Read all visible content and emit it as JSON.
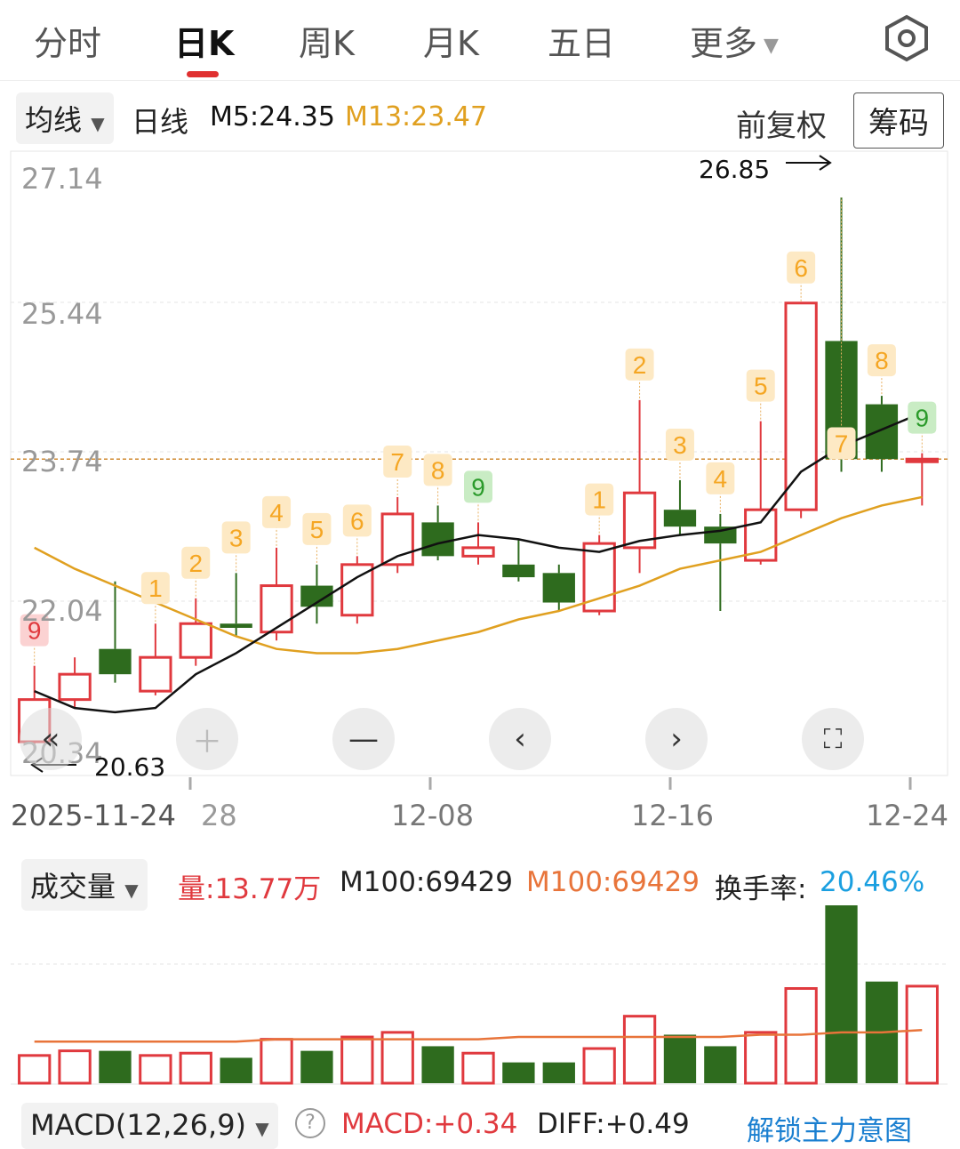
{
  "tabs": [
    {
      "label": "分时"
    },
    {
      "label": "日K"
    },
    {
      "label": "周K"
    },
    {
      "label": "月K"
    },
    {
      "label": "五日"
    },
    {
      "label": "更多"
    }
  ],
  "indicators": {
    "ma_selector": "均线",
    "period": "日线",
    "m5": "M5:24.35",
    "m13": "M13:23.47",
    "adjust": "前复权",
    "chip_button": "筹码"
  },
  "price_axis": {
    "labels": [
      "27.14",
      "25.44",
      "23.74",
      "22.04",
      "20.34"
    ]
  },
  "extremes": {
    "high_label": "26.85",
    "low_label": "20.63"
  },
  "date_axis": {
    "labels": [
      "2025-11-24",
      "28",
      "12-08",
      "12-16",
      "12-24"
    ]
  },
  "volume_header": {
    "selector": "成交量",
    "vol": "量:13.77万",
    "m100_a": "M100:69429",
    "m100_b": "M100:69429",
    "turnover_label": "换手率:",
    "turnover_value": "20.46%"
  },
  "macd_header": {
    "selector": "MACD(12,26,9)",
    "macd": "MACD:+0.34",
    "diff": "DIFF:+0.49",
    "link": "解锁主力意图"
  },
  "colors": {
    "up": "#e0393e",
    "down": "#2e6b1e",
    "ma5": "#111111",
    "ma13": "#e0a020",
    "turnover": "#1a9fe0",
    "badge": "#f5a623"
  },
  "chart_data": {
    "type": "candlestick",
    "ylim": [
      20.0,
      27.4
    ],
    "candles": [
      {
        "o": 20.4,
        "c": 20.9,
        "h": 21.3,
        "l": 20.3
      },
      {
        "o": 20.9,
        "c": 21.2,
        "h": 21.4,
        "l": 20.8
      },
      {
        "o": 21.5,
        "c": 21.2,
        "h": 22.3,
        "l": 21.1
      },
      {
        "o": 21.0,
        "c": 21.4,
        "h": 21.8,
        "l": 20.95
      },
      {
        "o": 21.4,
        "c": 21.8,
        "h": 22.1,
        "l": 21.3
      },
      {
        "o": 21.8,
        "c": 21.75,
        "h": 22.4,
        "l": 21.65
      },
      {
        "o": 21.7,
        "c": 22.25,
        "h": 22.7,
        "l": 21.6
      },
      {
        "o": 22.25,
        "c": 22.0,
        "h": 22.5,
        "l": 21.8
      },
      {
        "o": 21.9,
        "c": 22.5,
        "h": 22.6,
        "l": 21.8
      },
      {
        "o": 22.5,
        "c": 23.1,
        "h": 23.3,
        "l": 22.4
      },
      {
        "o": 23.0,
        "c": 22.6,
        "h": 23.2,
        "l": 22.55
      },
      {
        "o": 22.6,
        "c": 22.7,
        "h": 23.0,
        "l": 22.5
      },
      {
        "o": 22.5,
        "c": 22.35,
        "h": 22.8,
        "l": 22.3
      },
      {
        "o": 22.4,
        "c": 22.05,
        "h": 22.5,
        "l": 21.95
      },
      {
        "o": 21.95,
        "c": 22.75,
        "h": 22.85,
        "l": 21.9
      },
      {
        "o": 22.7,
        "c": 23.35,
        "h": 24.45,
        "l": 22.4
      },
      {
        "o": 23.15,
        "c": 22.95,
        "h": 23.5,
        "l": 22.85
      },
      {
        "o": 22.95,
        "c": 22.75,
        "h": 23.1,
        "l": 21.95
      },
      {
        "o": 22.55,
        "c": 23.15,
        "h": 24.2,
        "l": 22.5
      },
      {
        "o": 23.15,
        "c": 25.6,
        "h": 25.6,
        "l": 23.05
      },
      {
        "o": 25.15,
        "c": 23.75,
        "h": 26.85,
        "l": 23.6
      },
      {
        "o": 24.4,
        "c": 23.75,
        "h": 24.5,
        "l": 23.6
      },
      {
        "o": 23.72,
        "c": 23.75,
        "h": 23.82,
        "l": 23.2
      }
    ],
    "ma5": [
      21.0,
      20.8,
      20.75,
      20.8,
      21.2,
      21.45,
      21.75,
      22.05,
      22.35,
      22.6,
      22.75,
      22.85,
      22.8,
      22.7,
      22.65,
      22.78,
      22.85,
      22.9,
      23.0,
      23.6,
      23.9,
      24.1,
      24.3
    ],
    "ma13": [
      22.7,
      22.45,
      22.25,
      22.05,
      21.85,
      21.65,
      21.5,
      21.45,
      21.45,
      21.5,
      21.6,
      21.7,
      21.85,
      21.95,
      22.1,
      22.25,
      22.45,
      22.55,
      22.65,
      22.85,
      23.05,
      23.2,
      23.3
    ],
    "nine_turn": [
      {
        "i": 0,
        "label": "9",
        "type": "up-red"
      },
      {
        "i": 3,
        "label": "1"
      },
      {
        "i": 4,
        "label": "2"
      },
      {
        "i": 5,
        "label": "3"
      },
      {
        "i": 6,
        "label": "4"
      },
      {
        "i": 7,
        "label": "5"
      },
      {
        "i": 8,
        "label": "6"
      },
      {
        "i": 9,
        "label": "7"
      },
      {
        "i": 10,
        "label": "8"
      },
      {
        "i": 11,
        "label": "9",
        "type": "green"
      },
      {
        "i": 14,
        "label": "1"
      },
      {
        "i": 15,
        "label": "2"
      },
      {
        "i": 16,
        "label": "3"
      },
      {
        "i": 17,
        "label": "4"
      },
      {
        "i": 18,
        "label": "5"
      },
      {
        "i": 19,
        "label": "6"
      },
      {
        "i": 20,
        "label": "7",
        "below": true
      },
      {
        "i": 21,
        "label": "8"
      },
      {
        "i": 22,
        "label": "9",
        "type": "green"
      }
    ],
    "ref_line": 23.75,
    "volume": [
      0.12,
      0.14,
      0.14,
      0.12,
      0.13,
      0.11,
      0.19,
      0.14,
      0.2,
      0.22,
      0.16,
      0.13,
      0.09,
      0.09,
      0.15,
      0.29,
      0.21,
      0.16,
      0.22,
      0.41,
      0.77,
      0.44,
      0.42
    ],
    "volume_ma": [
      0.18,
      0.18,
      0.18,
      0.18,
      0.18,
      0.18,
      0.19,
      0.19,
      0.19,
      0.19,
      0.19,
      0.19,
      0.2,
      0.2,
      0.2,
      0.2,
      0.2,
      0.2,
      0.21,
      0.21,
      0.22,
      0.22,
      0.23
    ]
  }
}
